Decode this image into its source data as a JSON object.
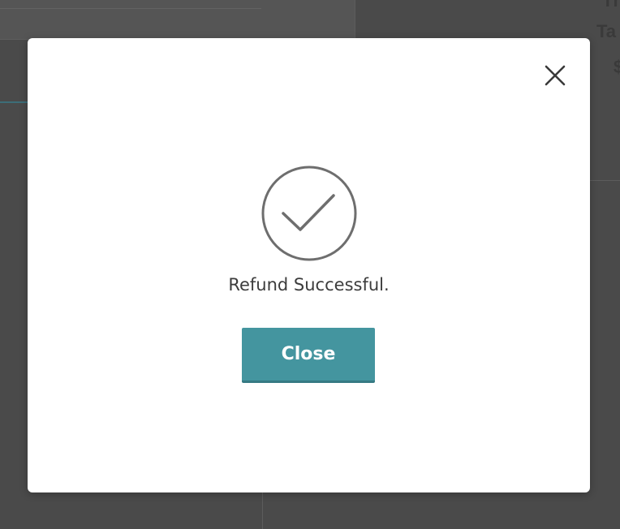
{
  "background": {
    "fragments": [
      "Th",
      "Ta",
      "$"
    ]
  },
  "modal": {
    "close_icon": "close-icon",
    "status_icon": "checkmark-circle-icon",
    "message": "Refund Successful.",
    "close_button_label": "Close",
    "colors": {
      "accent": "#44959f",
      "overlay": "#4a4a4a",
      "icon": "#6e6e6e",
      "text": "#3c3c3c"
    }
  }
}
